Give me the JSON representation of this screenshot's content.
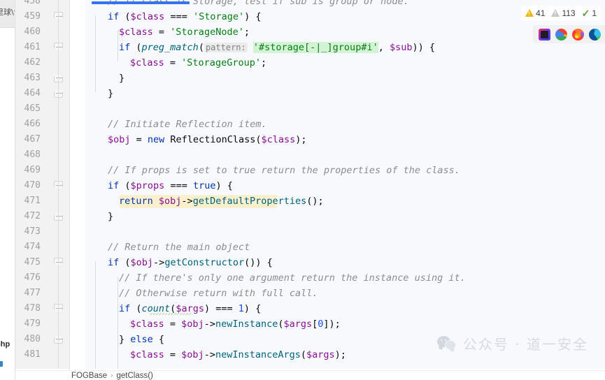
{
  "window": {
    "left_strip": {
      "tab_label": "里球\\f",
      "file_label": "php",
      "marker": ""
    }
  },
  "editor": {
    "first_line_number": 458,
    "last_line_number": 481,
    "line_height": 22,
    "colors": {
      "background": "#f7f9fc",
      "gutter": "#f2f2f2",
      "comment": "#8c8c8c",
      "keyword": "#0033b3",
      "string": "#067d17",
      "variable": "#871094",
      "number": "#1750eb",
      "function": "#00627a",
      "highlight_line": "#faf0cd",
      "search_match": "#d4f3d4",
      "selection_bar": "#3574f0"
    },
    "line_numbers": [
      "458",
      "459",
      "460",
      "461",
      "462",
      "463",
      "464",
      "465",
      "466",
      "467",
      "468",
      "469",
      "470",
      "471",
      "472",
      "473",
      "474",
      "475",
      "476",
      "477",
      "478",
      "479",
      "480",
      "481"
    ],
    "lines": [
      {
        "n": "458",
        "indent": 2,
        "tokens": [
          {
            "t": "// If class is Storage, test if sub is group or node.",
            "c": "comment"
          }
        ]
      },
      {
        "n": "459",
        "indent": 2,
        "tokens": [
          {
            "t": "if ",
            "c": "kw"
          },
          {
            "t": "(",
            "c": "plain"
          },
          {
            "t": "$class",
            "c": "var"
          },
          {
            "t": " === ",
            "c": "plain"
          },
          {
            "t": "'Storage'",
            "c": "str"
          },
          {
            "t": ") {",
            "c": "plain"
          }
        ]
      },
      {
        "n": "460",
        "indent": 3,
        "tokens": [
          {
            "t": "$class",
            "c": "var"
          },
          {
            "t": " = ",
            "c": "plain"
          },
          {
            "t": "'StorageNode'",
            "c": "str"
          },
          {
            "t": ";",
            "c": "plain"
          }
        ]
      },
      {
        "n": "461",
        "indent": 3,
        "tokens": [
          {
            "t": "if ",
            "c": "kw"
          },
          {
            "t": "(",
            "c": "plain"
          },
          {
            "t": "preg_match",
            "c": "fnital"
          },
          {
            "t": "(",
            "c": "plain"
          },
          {
            "t": "pattern:",
            "c": "hint"
          },
          {
            "t": " ",
            "c": "plain"
          },
          {
            "t": "'#storage[-|_]group#i'",
            "c": "str-hl"
          },
          {
            "t": ", ",
            "c": "plain"
          },
          {
            "t": "$sub",
            "c": "var"
          },
          {
            "t": ")) {",
            "c": "plain"
          }
        ]
      },
      {
        "n": "462",
        "indent": 4,
        "tokens": [
          {
            "t": "$class",
            "c": "var"
          },
          {
            "t": " = ",
            "c": "plain"
          },
          {
            "t": "'StorageGroup'",
            "c": "str"
          },
          {
            "t": ";",
            "c": "plain"
          }
        ]
      },
      {
        "n": "463",
        "indent": 3,
        "tokens": [
          {
            "t": "}",
            "c": "plain"
          }
        ]
      },
      {
        "n": "464",
        "indent": 2,
        "tokens": [
          {
            "t": "}",
            "c": "plain"
          }
        ]
      },
      {
        "n": "465",
        "indent": 0,
        "tokens": []
      },
      {
        "n": "466",
        "indent": 2,
        "tokens": [
          {
            "t": "// Initiate Reflection item.",
            "c": "comment"
          }
        ]
      },
      {
        "n": "467",
        "indent": 2,
        "tokens": [
          {
            "t": "$obj",
            "c": "var"
          },
          {
            "t": " = ",
            "c": "plain"
          },
          {
            "t": "new ",
            "c": "kw"
          },
          {
            "t": "ReflectionClass",
            "c": "plain"
          },
          {
            "t": "(",
            "c": "plain"
          },
          {
            "t": "$class",
            "c": "var"
          },
          {
            "t": ");",
            "c": "plain"
          }
        ]
      },
      {
        "n": "468",
        "indent": 0,
        "tokens": []
      },
      {
        "n": "469",
        "indent": 2,
        "tokens": [
          {
            "t": "// If props is set to true return the properties of the class.",
            "c": "comment"
          }
        ]
      },
      {
        "n": "470",
        "indent": 2,
        "tokens": [
          {
            "t": "if ",
            "c": "kw"
          },
          {
            "t": "(",
            "c": "plain"
          },
          {
            "t": "$props",
            "c": "var"
          },
          {
            "t": " === ",
            "c": "plain"
          },
          {
            "t": "true",
            "c": "kw"
          },
          {
            "t": ") {",
            "c": "plain"
          }
        ]
      },
      {
        "n": "471",
        "indent": 3,
        "highlight": true,
        "tokens": [
          {
            "t": "return ",
            "c": "kw"
          },
          {
            "t": "$obj",
            "c": "var"
          },
          {
            "t": "->",
            "c": "plain"
          },
          {
            "t": "getDefaultProperties",
            "c": "fn"
          },
          {
            "t": "();",
            "c": "plain"
          }
        ]
      },
      {
        "n": "472",
        "indent": 2,
        "tokens": [
          {
            "t": "}",
            "c": "plain"
          }
        ]
      },
      {
        "n": "473",
        "indent": 0,
        "tokens": []
      },
      {
        "n": "474",
        "indent": 2,
        "tokens": [
          {
            "t": "// Return the main object",
            "c": "comment"
          }
        ]
      },
      {
        "n": "475",
        "indent": 2,
        "tokens": [
          {
            "t": "if ",
            "c": "kw"
          },
          {
            "t": "(",
            "c": "plain"
          },
          {
            "t": "$obj",
            "c": "var"
          },
          {
            "t": "->",
            "c": "plain"
          },
          {
            "t": "getConstructor",
            "c": "fn"
          },
          {
            "t": "()) {",
            "c": "plain"
          }
        ]
      },
      {
        "n": "476",
        "indent": 3,
        "tokens": [
          {
            "t": "// If there's only one argument return the instance using it.",
            "c": "comment"
          }
        ]
      },
      {
        "n": "477",
        "indent": 3,
        "tokens": [
          {
            "t": "// Otherwise return with full call.",
            "c": "comment"
          }
        ]
      },
      {
        "n": "478",
        "indent": 3,
        "tokens": [
          {
            "t": "if ",
            "c": "kw"
          },
          {
            "t": "(",
            "c": "plain"
          },
          {
            "t": "count",
            "c": "fnital"
          },
          {
            "t": "(",
            "c": "plain"
          },
          {
            "t": "$args",
            "c": "var"
          },
          {
            "t": ") === ",
            "c": "plain"
          },
          {
            "t": "1",
            "c": "num"
          },
          {
            "t": ") {",
            "c": "plain"
          }
        ]
      },
      {
        "n": "479",
        "indent": 4,
        "tokens": [
          {
            "t": "$class",
            "c": "var"
          },
          {
            "t": " = ",
            "c": "plain"
          },
          {
            "t": "$obj",
            "c": "var"
          },
          {
            "t": "->",
            "c": "plain"
          },
          {
            "t": "newInstance",
            "c": "fn"
          },
          {
            "t": "(",
            "c": "plain"
          },
          {
            "t": "$args",
            "c": "var"
          },
          {
            "t": "[",
            "c": "plain"
          },
          {
            "t": "0",
            "c": "num"
          },
          {
            "t": "]);",
            "c": "plain"
          }
        ]
      },
      {
        "n": "480",
        "indent": 3,
        "tokens": [
          {
            "t": "} ",
            "c": "plain"
          },
          {
            "t": "else",
            "c": "kw"
          },
          {
            "t": " {",
            "c": "plain"
          }
        ]
      },
      {
        "n": "481",
        "indent": 4,
        "tokens": [
          {
            "t": "$class",
            "c": "var"
          },
          {
            "t": " = ",
            "c": "plain"
          },
          {
            "t": "$obj",
            "c": "var"
          },
          {
            "t": "->",
            "c": "plain"
          },
          {
            "t": "newInstanceArgs",
            "c": "fn"
          },
          {
            "t": "(",
            "c": "plain"
          },
          {
            "t": "$args",
            "c": "var"
          },
          {
            "t": ");",
            "c": "plain"
          }
        ]
      }
    ]
  },
  "inspections": {
    "warning_icon": "warning-triangle-icon",
    "warning_count": "41",
    "weak_warning_icon": "weak-warning-triangle-icon",
    "weak_warning_count": "113",
    "ok_icon": "inspection-ok-icon",
    "ok_count": "1"
  },
  "browsers": [
    {
      "name": "jetbrains-browser-icon",
      "label": "JetBrains IDE Browser"
    },
    {
      "name": "chrome-browser-icon",
      "label": "Google Chrome"
    },
    {
      "name": "firefox-browser-icon",
      "label": "Mozilla Firefox"
    },
    {
      "name": "edge-browser-icon",
      "label": "Microsoft Edge"
    }
  ],
  "breadcrumb": {
    "items": [
      "FOGBase",
      "getClass()"
    ],
    "separator": "›"
  },
  "watermark": {
    "icon": "wechat-logo-icon",
    "text": "公众号 · 道一安全"
  }
}
